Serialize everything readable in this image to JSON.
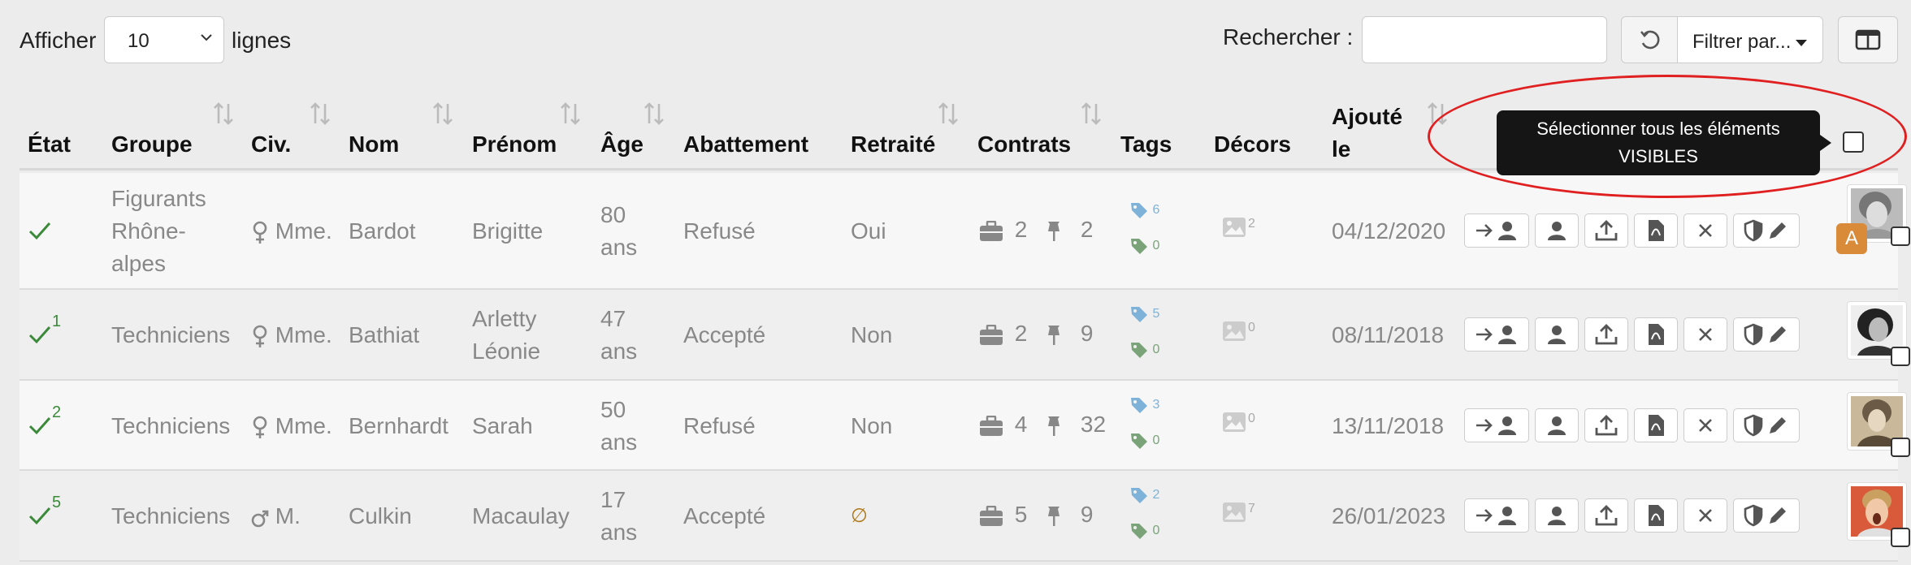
{
  "length_menu": {
    "prefix": "Afficher",
    "value": "10",
    "suffix": "lignes"
  },
  "search": {
    "label": "Rechercher :",
    "value": ""
  },
  "filter": {
    "label": "Filtrer par..."
  },
  "columns": [
    {
      "label": "État"
    },
    {
      "label": "Groupe"
    },
    {
      "label": "Civ."
    },
    {
      "label": "Nom"
    },
    {
      "label": "Prénom"
    },
    {
      "label": "Âge"
    },
    {
      "label": "Abattement"
    },
    {
      "label": "Retraité"
    },
    {
      "label": "Contrats"
    },
    {
      "label": "Tags"
    },
    {
      "label": "Décors"
    },
    {
      "label": "Ajouté le"
    }
  ],
  "tooltip": {
    "line1": "Sélectionner tous les éléments",
    "line2": "VISIBLES"
  },
  "rows": [
    {
      "state_sup": "",
      "groupe": "Figurants Rhône-alpes",
      "civ": "Mme.",
      "civ_icon": "female-icon",
      "nom": "Bardot",
      "prenom": "Brigitte",
      "age": "80 ans",
      "abattement": "Refusé",
      "retraite": "Oui",
      "contrats": "2",
      "pins": "2",
      "tags_blue": "6",
      "tags_green": "0",
      "decors": "2",
      "ajoute": "04/12/2020",
      "badge": "A"
    },
    {
      "state_sup": "1",
      "groupe": "Techniciens",
      "civ": "Mme.",
      "civ_icon": "female-icon",
      "nom": "Bathiat",
      "prenom": "Arletty Léonie",
      "age": "47 ans",
      "abattement": "Accepté",
      "retraite": "Non",
      "contrats": "2",
      "pins": "9",
      "tags_blue": "5",
      "tags_green": "0",
      "decors": "0",
      "ajoute": "08/11/2018",
      "badge": ""
    },
    {
      "state_sup": "2",
      "groupe": "Techniciens",
      "civ": "Mme.",
      "civ_icon": "female-icon",
      "nom": "Bernhardt",
      "prenom": "Sarah",
      "age": "50 ans",
      "abattement": "Refusé",
      "retraite": "Non",
      "contrats": "4",
      "pins": "32",
      "tags_blue": "3",
      "tags_green": "0",
      "decors": "0",
      "ajoute": "13/11/2018",
      "badge": ""
    },
    {
      "state_sup": "5",
      "groupe": "Techniciens",
      "civ": "M.",
      "civ_icon": "male-icon",
      "nom": "Culkin",
      "prenom": "Macaulay",
      "age": "17 ans",
      "abattement": "Accepté",
      "retraite": "∅",
      "contrats": "5",
      "pins": "9",
      "tags_blue": "2",
      "tags_green": "0",
      "decors": "7",
      "ajoute": "26/01/2023",
      "badge": ""
    }
  ],
  "colors": {
    "check": "#3a8a3a",
    "tag_blue": "#7fb2d8",
    "tag_green": "#7aa37a",
    "badge": "#d98b3a",
    "highlight": "#e02020",
    "null_sign": "#b07a1a"
  }
}
